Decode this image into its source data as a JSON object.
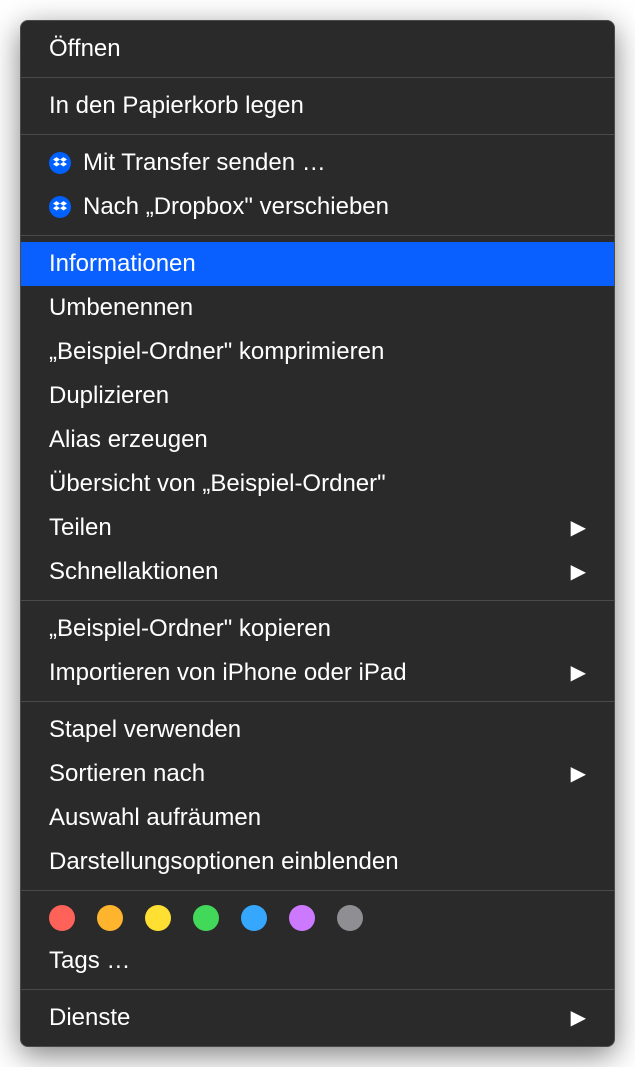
{
  "menu": {
    "open": "Öffnen",
    "trash": "In den Papierkorb legen",
    "dropbox_transfer": "Mit Transfer senden …",
    "dropbox_move": "Nach „Dropbox\" verschieben",
    "get_info": "Informationen",
    "rename": "Umbenennen",
    "compress": "„Beispiel-Ordner\" komprimieren",
    "duplicate": "Duplizieren",
    "make_alias": "Alias erzeugen",
    "quick_look": "Übersicht von „Beispiel-Ordner\"",
    "share": "Teilen",
    "quick_actions": "Schnellaktionen",
    "copy": "„Beispiel-Ordner\" kopieren",
    "import_from_device": "Importieren von iPhone oder iPad",
    "use_stacks": "Stapel verwenden",
    "sort_by": "Sortieren nach",
    "clean_up_selection": "Auswahl aufräumen",
    "show_view_options": "Darstellungsoptionen einblenden",
    "tags_more": "Tags …",
    "services": "Dienste"
  },
  "tag_colors": [
    "#ff6259",
    "#feb42d",
    "#fedf32",
    "#42d85a",
    "#35a8fd",
    "#cd79ff",
    "#8e8e93"
  ]
}
